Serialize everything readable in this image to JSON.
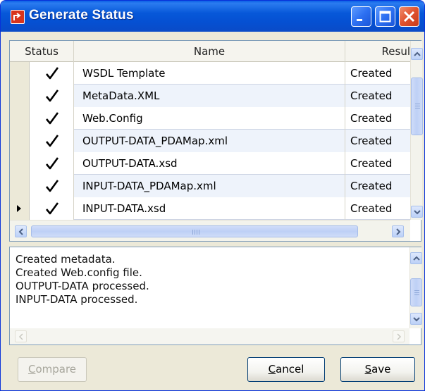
{
  "window": {
    "title": "Generate Status",
    "controls": [
      "minimize-icon",
      "maximize-icon",
      "close-icon"
    ]
  },
  "grid": {
    "columns": [
      "Status",
      "Name",
      "Resul"
    ],
    "rows": [
      {
        "status": "check-icon",
        "name": "WSDL Template",
        "result": "Created"
      },
      {
        "status": "check-icon",
        "name": "MetaData.XML",
        "result": "Created"
      },
      {
        "status": "check-icon",
        "name": "Web.Config",
        "result": "Created"
      },
      {
        "status": "check-icon",
        "name": "OUTPUT-DATA_PDAMap.xml",
        "result": "Created"
      },
      {
        "status": "check-icon",
        "name": "OUTPUT-DATA.xsd",
        "result": "Created"
      },
      {
        "status": "check-icon",
        "name": "INPUT-DATA_PDAMap.xml",
        "result": "Created"
      },
      {
        "status": "check-icon",
        "name": "INPUT-DATA.xsd",
        "result": "Created",
        "current": true
      }
    ]
  },
  "log": {
    "lines": [
      "Created metadata.",
      "Created Web.config file.",
      "OUTPUT-DATA processed.",
      "INPUT-DATA processed."
    ]
  },
  "buttons": {
    "compare": {
      "pre": "",
      "key": "C",
      "post": "ompare",
      "enabled": false
    },
    "cancel": {
      "pre": "",
      "key": "C",
      "post": "ancel",
      "enabled": true
    },
    "save": {
      "pre": "",
      "key": "S",
      "post": "ave",
      "enabled": true
    }
  },
  "colors": {
    "titlebar": "#0550d2",
    "close_button": "#e0522e",
    "window_bg": "#ece9d8",
    "alt_row": "#eef3fb"
  }
}
